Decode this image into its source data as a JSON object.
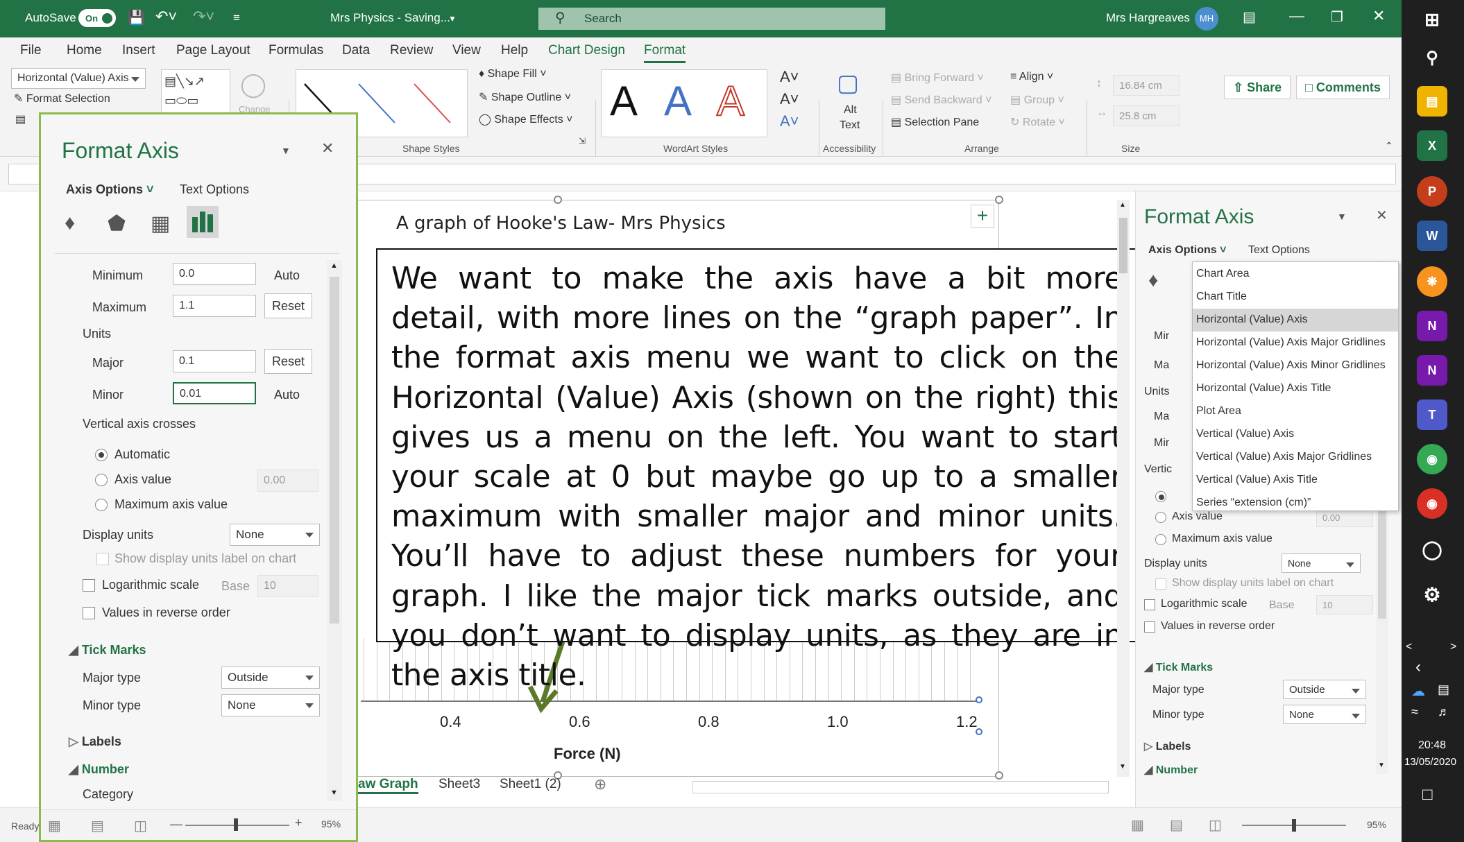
{
  "titlebar": {
    "autosave_label": "AutoSave",
    "autosave_state": "On",
    "doc_title": "Mrs Physics - Saving...",
    "search_placeholder": "Search",
    "user_name": "Mrs Hargreaves",
    "user_initials": "MH"
  },
  "ribbon": {
    "menus": [
      "File",
      "Home",
      "Insert",
      "Page Layout",
      "Formulas",
      "Data",
      "Review",
      "View",
      "Help",
      "Chart Design",
      "Format"
    ],
    "element_selector": "Horizontal (Value) Axis",
    "format_selection": "Format Selection",
    "shape_fill": "Shape Fill",
    "shape_outline": "Shape Outline",
    "shape_effects": "Shape Effects",
    "alt_text_1": "Alt",
    "alt_text_2": "Text",
    "bring_forward": "Bring Forward",
    "send_backward": "Send Backward",
    "selection_pane": "Selection Pane",
    "align": "Align",
    "group": "Group",
    "rotate": "Rotate",
    "height": "16.84 cm",
    "width": "25.8 cm",
    "change_label": "Change",
    "groups": {
      "shape_styles": "Shape Styles",
      "wordart_styles": "WordArt Styles",
      "accessibility": "Accessibility",
      "arrange": "Arrange",
      "size": "Size"
    },
    "share": "Share",
    "comments": "Comments",
    "wordart_letter": "A"
  },
  "chart": {
    "title": "A graph of Hooke's Law- Mrs Physics",
    "x_ticks": [
      "0.4",
      "0.6",
      "0.8",
      "1.0",
      "1.2"
    ],
    "x_axis_title": "Force (N)"
  },
  "callout": "We want to make the axis have a bit more detail, with more lines on the “graph paper”. In the format axis menu we want to click on the Horizontal (Value) Axis (shown on the right) this gives us a menu on the left. You want to start your scale at 0 but maybe go up to a smaller maximum with smaller major and minor units. You’ll have to adjust these numbers for your graph. I like the major tick marks outside, and you don’t want to display units, as they are in the axis title.",
  "left_panel": {
    "title": "Format Axis",
    "tab_axis": "Axis Options",
    "tab_text": "Text Options",
    "minimum_label": "Minimum",
    "minimum_value": "0.0",
    "minimum_btn": "Auto",
    "maximum_label": "Maximum",
    "maximum_value": "1.1",
    "maximum_btn": "Reset",
    "units_label": "Units",
    "major_label": "Major",
    "major_value": "0.1",
    "major_btn": "Reset",
    "minor_label": "Minor",
    "minor_value": "0.01",
    "minor_btn": "Auto",
    "crosses_label": "Vertical axis crosses",
    "automatic": "Automatic",
    "axis_value": "Axis value",
    "axis_value_num": "0.00",
    "max_axis_value": "Maximum axis value",
    "display_units": "Display units",
    "display_units_value": "None",
    "show_units_label": "Show display units label on chart",
    "log_scale": "Logarithmic scale",
    "base_label": "Base",
    "base_value": "10",
    "reverse": "Values in reverse order",
    "tick_marks": "Tick Marks",
    "major_type": "Major type",
    "major_type_value": "Outside",
    "minor_type": "Minor type",
    "minor_type_value": "None",
    "labels": "Labels",
    "number": "Number",
    "category": "Category"
  },
  "right_panel": {
    "title": "Format Axis",
    "tab_axis": "Axis Options",
    "tab_text": "Text Options",
    "dropdown": [
      "Chart Area",
      "Chart Title",
      "Horizontal (Value) Axis",
      "Horizontal (Value) Axis Major Gridlines",
      "Horizontal (Value) Axis Minor Gridlines",
      "Horizontal (Value) Axis Title",
      "Plot Area",
      "Vertical (Value) Axis",
      "Vertical (Value) Axis Major Gridlines",
      "Vertical (Value) Axis Title",
      "Series “extension (cm)”"
    ],
    "partial_labels": [
      "Mir",
      "Ma",
      "Units",
      "Ma",
      "Mir",
      "Vertic"
    ],
    "axis_value": "Axis value",
    "axis_value_num": "0.00",
    "max_axis_value": "Maximum axis value",
    "display_units": "Display units",
    "display_units_value": "None",
    "show_units_label": "Show display units label on chart",
    "log_scale": "Logarithmic scale",
    "base_label": "Base",
    "base_value": "10",
    "reverse": "Values in reverse order",
    "tick_marks": "Tick Marks",
    "major_type": "Major type",
    "major_type_value": "Outside",
    "minor_type": "Minor type",
    "minor_type_value": "None",
    "labels": "Labels",
    "number": "Number"
  },
  "sheets": {
    "tab1": "aw Graph",
    "tab2": "Sheet3",
    "tab3": "Sheet1 (2)"
  },
  "status": {
    "ready": "Ready",
    "zoom_left": "95%",
    "zoom_right": "95%"
  },
  "taskbar": {
    "time": "20:48",
    "date": "13/05/2020"
  },
  "colors": {
    "excel_green": "#217346",
    "panel_border": "#8dba4c",
    "arrow": "#5a7a2a"
  }
}
